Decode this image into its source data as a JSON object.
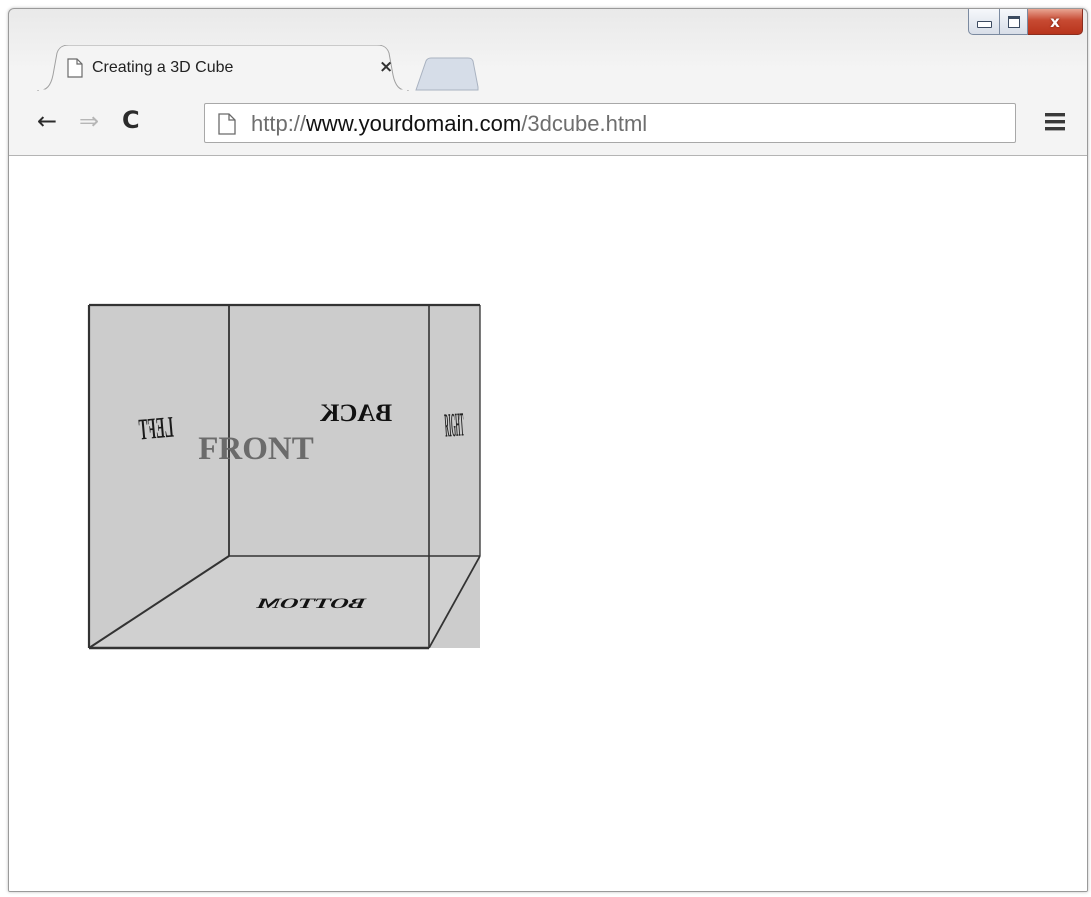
{
  "window": {
    "caption_buttons": {
      "minimize_icon": "minimize-icon",
      "maximize_icon": "maximize-icon",
      "close_icon": "close-icon",
      "close_glyph": "x"
    }
  },
  "tab": {
    "title": "Creating a 3D Cube",
    "close_glyph": "×",
    "icon": "page-icon"
  },
  "toolbar": {
    "back_glyph": "←",
    "forward_glyph": "⇒",
    "reload_glyph": "C",
    "url": {
      "scheme": "http://",
      "host": "www.yourdomain.com",
      "path": "/3dcube.html"
    },
    "menu_icon": "hamburger-menu-icon"
  },
  "cube": {
    "front": "FRONT",
    "back": "BACK",
    "left": "LEFT",
    "right": "RIGHT",
    "bottom": "BOTTOM"
  },
  "colors": {
    "face_fill": "#cccccc",
    "edge": "#333333",
    "front_text": "#6b6b6b",
    "close_red": "#c74a32"
  }
}
